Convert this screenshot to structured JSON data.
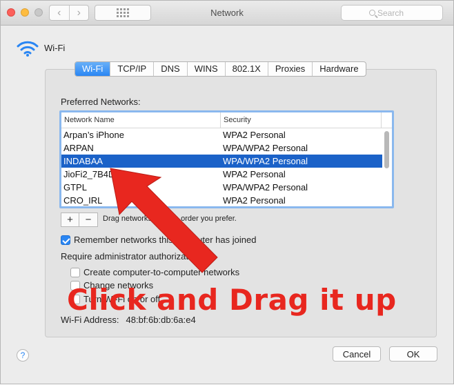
{
  "window": {
    "title": "Network"
  },
  "search": {
    "placeholder": "Search"
  },
  "header": {
    "label": "Wi-Fi",
    "icon": "wifi-icon"
  },
  "tabs": [
    {
      "label": "Wi-Fi",
      "active": true
    },
    {
      "label": "TCP/IP"
    },
    {
      "label": "DNS"
    },
    {
      "label": "WINS"
    },
    {
      "label": "802.1X"
    },
    {
      "label": "Proxies"
    },
    {
      "label": "Hardware"
    }
  ],
  "preferred": {
    "label": "Preferred Networks:",
    "columns": [
      "Network Name",
      "Security"
    ],
    "rows": [
      {
        "name": "Arpan’s iPhone",
        "security": "WPA2 Personal"
      },
      {
        "name": "ARPAN",
        "security": "WPA/WPA2 Personal"
      },
      {
        "name": "INDABAA",
        "security": "WPA/WPA2 Personal",
        "selected": true
      },
      {
        "name": "JioFi2_7B4D",
        "security": "WPA2 Personal"
      },
      {
        "name": "GTPL",
        "security": "WPA/WPA2 Personal"
      },
      {
        "name": "CRO_IRL",
        "security": "WPA2 Personal"
      }
    ]
  },
  "controls": {
    "add": "+",
    "remove": "−",
    "drag_hint": "Drag networks into the order you prefer."
  },
  "remember": {
    "label": "Remember networks this computer has joined",
    "checked": true
  },
  "admin": {
    "label": "Require administrator authorization to:",
    "options": [
      {
        "label": "Create computer-to-computer networks",
        "checked": false
      },
      {
        "label": "Change networks",
        "checked": false
      },
      {
        "label": "Turn Wi-Fi on or off",
        "checked": false
      }
    ]
  },
  "address": {
    "label": "Wi-Fi Address:",
    "value": "48:bf:6b:db:6a:e4"
  },
  "buttons": {
    "help": "?",
    "cancel": "Cancel",
    "ok": "OK"
  },
  "annotation": {
    "text": "Click and Drag it up",
    "color": "#e8271f"
  },
  "colors": {
    "accent": "#2a86f3",
    "selection": "#1b62c8"
  }
}
